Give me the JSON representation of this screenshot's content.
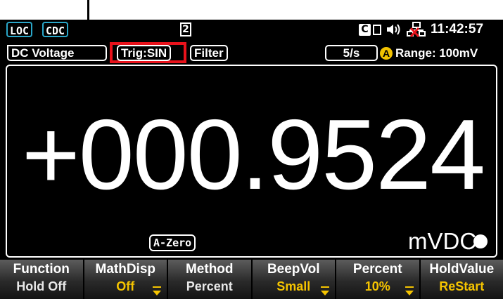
{
  "status_bar": {
    "loc": "LOC",
    "cdc": "CDC",
    "memory_slot": "2",
    "c_badge": "C",
    "time": "11:42:57"
  },
  "mode_bar": {
    "function": "DC Voltage",
    "trigger": "Trig:SIN",
    "filter": "Filter",
    "rate": "5/s",
    "range_badge": "A",
    "range": "Range: 100mV"
  },
  "display": {
    "reading": "+000.9524",
    "azero": "A-Zero",
    "unit": "mVDC"
  },
  "softkeys": [
    {
      "label": "Function",
      "value": "Hold Off",
      "style": "white",
      "dropdown": false
    },
    {
      "label": "MathDisp",
      "value": "Off",
      "style": "yellow",
      "dropdown": true
    },
    {
      "label": "Method",
      "value": "Percent",
      "style": "white",
      "dropdown": false
    },
    {
      "label": "BeepVol",
      "value": "Small",
      "style": "yellow",
      "dropdown": true
    },
    {
      "label": "Percent",
      "value": "10%",
      "style": "yellow",
      "dropdown": true
    },
    {
      "label": "HoldValue",
      "value": "ReStart",
      "style": "yellow",
      "dropdown": false
    }
  ],
  "colors": {
    "highlight_box": "#e8121b",
    "badge_border": "#2aa7c9",
    "softkey_value": "#f5c400"
  }
}
